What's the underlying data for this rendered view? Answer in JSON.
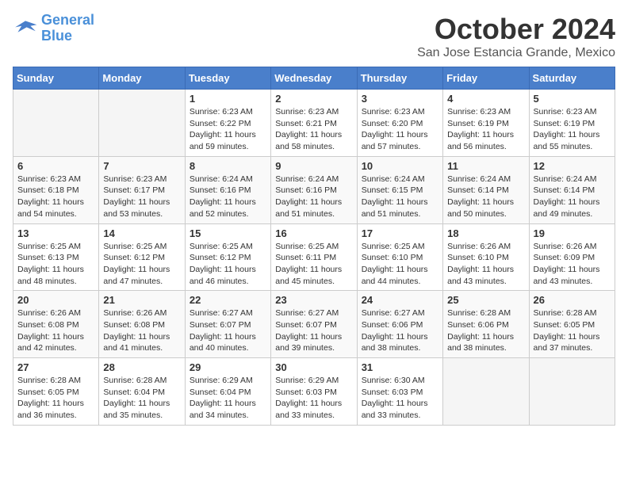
{
  "header": {
    "logo_line1": "General",
    "logo_line2": "Blue",
    "month": "October 2024",
    "location": "San Jose Estancia Grande, Mexico"
  },
  "weekdays": [
    "Sunday",
    "Monday",
    "Tuesday",
    "Wednesday",
    "Thursday",
    "Friday",
    "Saturday"
  ],
  "weeks": [
    [
      {
        "day": "",
        "info": ""
      },
      {
        "day": "",
        "info": ""
      },
      {
        "day": "1",
        "info": "Sunrise: 6:23 AM\nSunset: 6:22 PM\nDaylight: 11 hours and 59 minutes."
      },
      {
        "day": "2",
        "info": "Sunrise: 6:23 AM\nSunset: 6:21 PM\nDaylight: 11 hours and 58 minutes."
      },
      {
        "day": "3",
        "info": "Sunrise: 6:23 AM\nSunset: 6:20 PM\nDaylight: 11 hours and 57 minutes."
      },
      {
        "day": "4",
        "info": "Sunrise: 6:23 AM\nSunset: 6:19 PM\nDaylight: 11 hours and 56 minutes."
      },
      {
        "day": "5",
        "info": "Sunrise: 6:23 AM\nSunset: 6:19 PM\nDaylight: 11 hours and 55 minutes."
      }
    ],
    [
      {
        "day": "6",
        "info": "Sunrise: 6:23 AM\nSunset: 6:18 PM\nDaylight: 11 hours and 54 minutes."
      },
      {
        "day": "7",
        "info": "Sunrise: 6:23 AM\nSunset: 6:17 PM\nDaylight: 11 hours and 53 minutes."
      },
      {
        "day": "8",
        "info": "Sunrise: 6:24 AM\nSunset: 6:16 PM\nDaylight: 11 hours and 52 minutes."
      },
      {
        "day": "9",
        "info": "Sunrise: 6:24 AM\nSunset: 6:16 PM\nDaylight: 11 hours and 51 minutes."
      },
      {
        "day": "10",
        "info": "Sunrise: 6:24 AM\nSunset: 6:15 PM\nDaylight: 11 hours and 51 minutes."
      },
      {
        "day": "11",
        "info": "Sunrise: 6:24 AM\nSunset: 6:14 PM\nDaylight: 11 hours and 50 minutes."
      },
      {
        "day": "12",
        "info": "Sunrise: 6:24 AM\nSunset: 6:14 PM\nDaylight: 11 hours and 49 minutes."
      }
    ],
    [
      {
        "day": "13",
        "info": "Sunrise: 6:25 AM\nSunset: 6:13 PM\nDaylight: 11 hours and 48 minutes."
      },
      {
        "day": "14",
        "info": "Sunrise: 6:25 AM\nSunset: 6:12 PM\nDaylight: 11 hours and 47 minutes."
      },
      {
        "day": "15",
        "info": "Sunrise: 6:25 AM\nSunset: 6:12 PM\nDaylight: 11 hours and 46 minutes."
      },
      {
        "day": "16",
        "info": "Sunrise: 6:25 AM\nSunset: 6:11 PM\nDaylight: 11 hours and 45 minutes."
      },
      {
        "day": "17",
        "info": "Sunrise: 6:25 AM\nSunset: 6:10 PM\nDaylight: 11 hours and 44 minutes."
      },
      {
        "day": "18",
        "info": "Sunrise: 6:26 AM\nSunset: 6:10 PM\nDaylight: 11 hours and 43 minutes."
      },
      {
        "day": "19",
        "info": "Sunrise: 6:26 AM\nSunset: 6:09 PM\nDaylight: 11 hours and 43 minutes."
      }
    ],
    [
      {
        "day": "20",
        "info": "Sunrise: 6:26 AM\nSunset: 6:08 PM\nDaylight: 11 hours and 42 minutes."
      },
      {
        "day": "21",
        "info": "Sunrise: 6:26 AM\nSunset: 6:08 PM\nDaylight: 11 hours and 41 minutes."
      },
      {
        "day": "22",
        "info": "Sunrise: 6:27 AM\nSunset: 6:07 PM\nDaylight: 11 hours and 40 minutes."
      },
      {
        "day": "23",
        "info": "Sunrise: 6:27 AM\nSunset: 6:07 PM\nDaylight: 11 hours and 39 minutes."
      },
      {
        "day": "24",
        "info": "Sunrise: 6:27 AM\nSunset: 6:06 PM\nDaylight: 11 hours and 38 minutes."
      },
      {
        "day": "25",
        "info": "Sunrise: 6:28 AM\nSunset: 6:06 PM\nDaylight: 11 hours and 38 minutes."
      },
      {
        "day": "26",
        "info": "Sunrise: 6:28 AM\nSunset: 6:05 PM\nDaylight: 11 hours and 37 minutes."
      }
    ],
    [
      {
        "day": "27",
        "info": "Sunrise: 6:28 AM\nSunset: 6:05 PM\nDaylight: 11 hours and 36 minutes."
      },
      {
        "day": "28",
        "info": "Sunrise: 6:28 AM\nSunset: 6:04 PM\nDaylight: 11 hours and 35 minutes."
      },
      {
        "day": "29",
        "info": "Sunrise: 6:29 AM\nSunset: 6:04 PM\nDaylight: 11 hours and 34 minutes."
      },
      {
        "day": "30",
        "info": "Sunrise: 6:29 AM\nSunset: 6:03 PM\nDaylight: 11 hours and 33 minutes."
      },
      {
        "day": "31",
        "info": "Sunrise: 6:30 AM\nSunset: 6:03 PM\nDaylight: 11 hours and 33 minutes."
      },
      {
        "day": "",
        "info": ""
      },
      {
        "day": "",
        "info": ""
      }
    ]
  ]
}
